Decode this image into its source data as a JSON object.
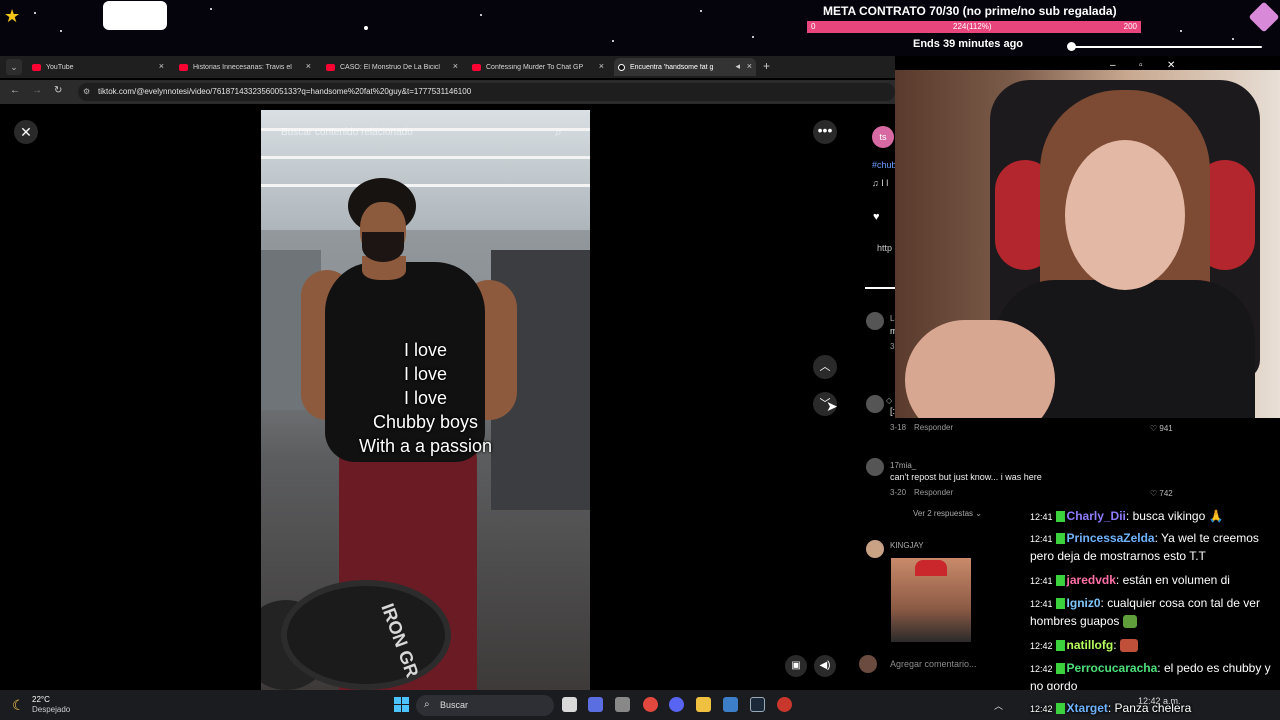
{
  "overlay": {
    "meta_title": "META CONTRATO 70/30 (no prime/no sub regalada)",
    "meta_min": "0",
    "meta_current": "224(112%)",
    "meta_max": "200",
    "meta_fill_fraction": 1.0,
    "meta_ends": "Ends 39 minutes ago",
    "accent_color": "#e8457c"
  },
  "browser": {
    "tabs": [
      {
        "label": "YouTube",
        "icon": "youtube-icon"
      },
      {
        "label": "Historias Innecesarias: Travis el",
        "icon": "youtube-icon"
      },
      {
        "label": "CASO: El Monstruo De La Bicicl",
        "icon": "youtube-icon"
      },
      {
        "label": "Confessing Murder To Chat GP",
        "icon": "youtube-icon"
      },
      {
        "label": "Encuentra 'handsome fat g",
        "icon": "tiktok-icon",
        "active": true
      }
    ],
    "url": "tiktok.com/@evelynnotesi/video/7618714332356005133?q=handsome%20fat%20guy&t=1777531146100"
  },
  "video": {
    "search_placeholder": "Buscar contenido relacionado",
    "caption_lines": [
      "I love",
      "I love",
      "I love",
      "Chubby boys",
      "With a a passion"
    ],
    "dumbbell_text": "IRON GR"
  },
  "side": {
    "avatar_initials": "ts",
    "tag": "#chub",
    "music": "♫ I l",
    "link": "http"
  },
  "comments": [
    {
      "name": "La",
      "text": "m",
      "date": "3",
      "reply": "",
      "likes": ""
    },
    {
      "name": "◇",
      "text": "[:",
      "date": "3-18",
      "reply": "Responder",
      "likes": "941"
    },
    {
      "name": "17mia_",
      "text": "can't repost but just know... i was here",
      "date": "3-20",
      "reply": "Responder",
      "likes": "742",
      "more": "Ver 2 respuestas"
    },
    {
      "name": "KINGJAY",
      "text": "",
      "date": "",
      "reply": "",
      "likes": ""
    }
  ],
  "comment_input": {
    "placeholder": "Agregar comentario..."
  },
  "chat": [
    {
      "time": "12:41",
      "user": "Charly_Dii",
      "color": "#8f7cff",
      "msg": "busca vikingo 🙏"
    },
    {
      "time": "12:41",
      "user": "PrincessaZelda",
      "color": "#6fb3ff",
      "msg": "Ya wel te creemos pero deja de mostrarnos esto T.T"
    },
    {
      "time": "12:41",
      "user": "jaredvdk",
      "color": "#ff6fa6",
      "msg": "están en volumen di"
    },
    {
      "time": "12:41",
      "user": "Igniz0",
      "color": "#7fc7ff",
      "msg": "cualquier cosa con tal de ver hombres guapos"
    },
    {
      "time": "12:42",
      "user": "natillofg",
      "color": "#b7ff5e",
      "msg": ""
    },
    {
      "time": "12:42",
      "user": "Perrocucaracha",
      "color": "#4ce07a",
      "msg": "el pedo es chubby y no gordo"
    },
    {
      "time": "12:42",
      "user": "Xtarget",
      "color": "#6fb3ff",
      "msg": "Panza chelera"
    }
  ],
  "taskbar": {
    "temp": "22°C",
    "condition": "Despejado",
    "search_label": "Buscar",
    "time": "12:42 a.m."
  }
}
